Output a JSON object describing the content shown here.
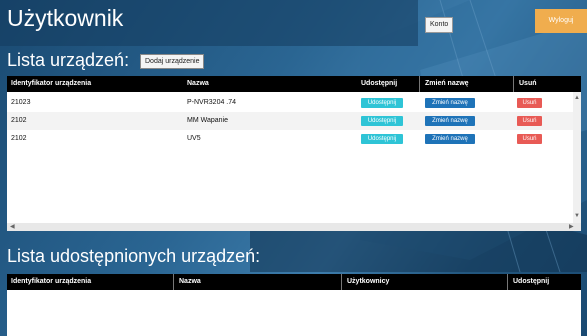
{
  "header": {
    "title": "Użytkownik",
    "account_button": "Konto",
    "logout_button": "Wyloguj"
  },
  "devices": {
    "section_title": "Lista urządzeń:",
    "add_button": "Dodaj urządzenie",
    "columns": [
      "Identyfikator urządzenia",
      "Nazwa",
      "Udostępnij",
      "Zmień nazwę",
      "Usuń"
    ],
    "rows": [
      {
        "id": "21023",
        "name": "P-NVR3204 .74",
        "share": "Udostępnij",
        "rename": "Zmień nazwę",
        "delete": "Usuń"
      },
      {
        "id": "2102",
        "name": "MM Wapanie",
        "share": "Udostępnij",
        "rename": "Zmień nazwę",
        "delete": "Usuń"
      },
      {
        "id": "2102",
        "name": "UV5",
        "share": "Udostępnij",
        "rename": "Zmień nazwę",
        "delete": "Usuń"
      }
    ]
  },
  "shared": {
    "section_title": "Lista udostępnionych urządzeń:",
    "columns": [
      "Identyfikator urządzenia",
      "Nazwa",
      "Użytkownicy",
      "Udostępnij"
    ]
  },
  "colors": {
    "share": "#2ec4d6",
    "rename": "#1e73b8",
    "delete": "#e85a55",
    "logout": "#f0ad4e"
  },
  "icons": {
    "scroll_left": "scroll-left-icon",
    "scroll_right": "scroll-right-icon",
    "scroll_up": "scroll-up-icon",
    "scroll_down": "scroll-down-icon"
  }
}
